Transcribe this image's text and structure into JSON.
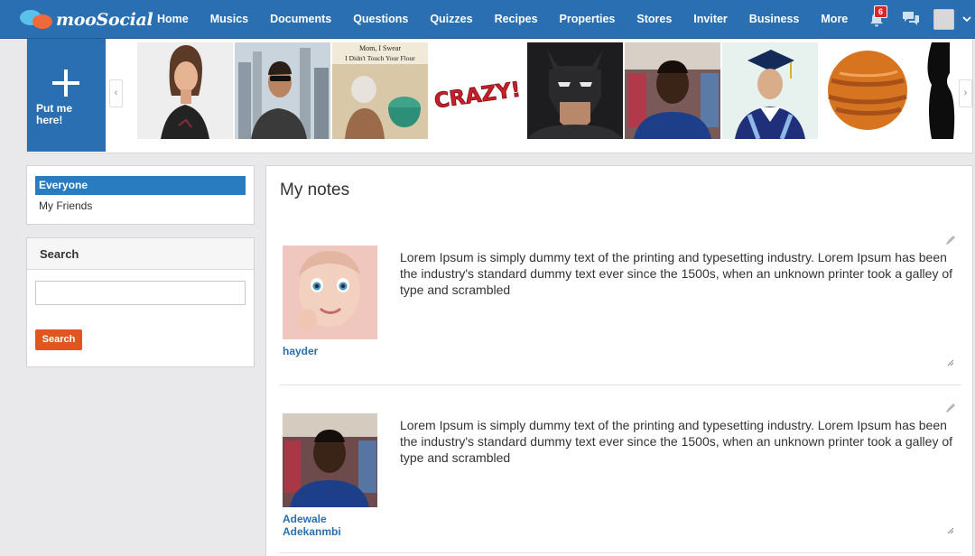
{
  "app": {
    "logo_text": "mooSocial"
  },
  "nav": {
    "items": [
      "Home",
      "Musics",
      "Documents",
      "Questions",
      "Quizzes",
      "Recipes",
      "Properties",
      "Stores",
      "Inviter",
      "Business",
      "More"
    ]
  },
  "header_icons": {
    "notification_count": "6",
    "icons": [
      "bell-icon",
      "chat-icon",
      "user-avatar",
      "chevron-down-icon"
    ]
  },
  "strip": {
    "put_me_label": "Put me here!",
    "prev_arrow": "‹",
    "next_arrow": "›",
    "thumb_texts": {
      "mom_line1": "Mom, I Swear",
      "mom_line2": "I Didn't Touch Your Flour",
      "crazy": "CRAZY!"
    }
  },
  "filters": {
    "items": [
      "Everyone",
      "My Friends"
    ]
  },
  "search": {
    "title": "Search",
    "input_value": "",
    "button_label": "Search"
  },
  "main": {
    "title": "My notes",
    "notes": [
      {
        "author": "hayder",
        "text": "Lorem Ipsum is simply dummy text of the printing and typesetting industry. Lorem Ipsum has been the industry's standard dummy text ever since the 1500s, when an unknown printer took a galley of type and scrambled"
      },
      {
        "author": "Adewale Adekanmbi",
        "text": "Lorem Ipsum is simply dummy text of the printing and typesetting industry. Lorem Ipsum has been the industry's standard dummy text ever since the 1500s, when an unknown printer took a galley of type and scrambled"
      }
    ]
  },
  "colors": {
    "brand_blue": "#2a6fb1",
    "active_filter": "#2a7cc1",
    "search_button": "#e0571e",
    "badge": "#d9262a",
    "author_link": "#2a6fb1"
  }
}
